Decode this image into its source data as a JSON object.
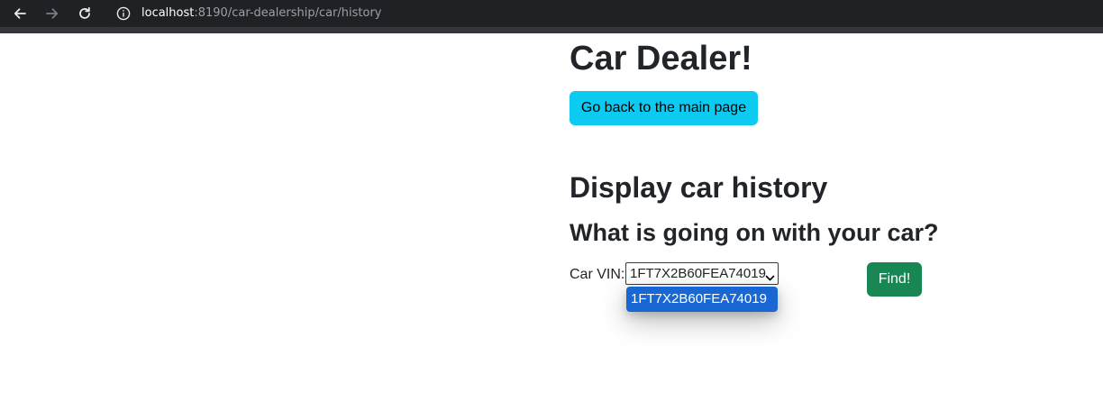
{
  "browser": {
    "url_host": "localhost",
    "url_rest": ":8190/car-dealership/car/history",
    "icons": [
      "back-arrow-icon",
      "forward-arrow-icon",
      "reload-icon",
      "info-icon"
    ]
  },
  "page": {
    "title": "Car Dealer!",
    "main_page_button": "Go back to the main page",
    "section_title": "Display car history",
    "section_subtitle": "What is going on with your car?"
  },
  "form": {
    "vin_label": "Car VIN:",
    "vin_selected": "1FT7X2B60FEA74019",
    "vin_options": [
      "1FT7X2B60FEA74019"
    ],
    "find_button": "Find!"
  },
  "colors": {
    "info_button": "#0dcaf0",
    "success_button": "#198754",
    "dropdown_highlight": "#1967d2"
  }
}
